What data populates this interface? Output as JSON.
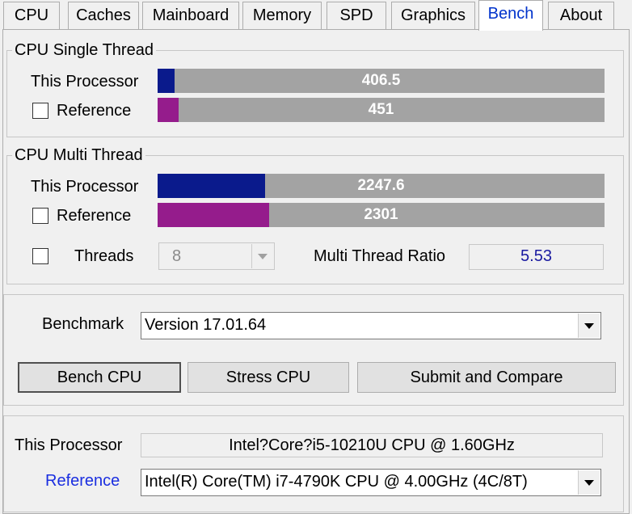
{
  "tabs": [
    {
      "label": "CPU"
    },
    {
      "label": "Caches"
    },
    {
      "label": "Mainboard"
    },
    {
      "label": "Memory"
    },
    {
      "label": "SPD"
    },
    {
      "label": "Graphics"
    },
    {
      "label": "Bench",
      "active": true
    },
    {
      "label": "About"
    }
  ],
  "single": {
    "title": "CPU Single Thread",
    "this_label": "This Processor",
    "this_value": "406.5",
    "this_fraction": 0.038,
    "ref_label": "Reference",
    "ref_checked": false,
    "ref_value": "451",
    "ref_fraction": 0.047
  },
  "multi": {
    "title": "CPU Multi Thread",
    "this_label": "This Processor",
    "this_value": "2247.6",
    "this_fraction": 0.24,
    "ref_label": "Reference",
    "ref_checked": false,
    "ref_value": "2301",
    "ref_fraction": 0.25,
    "threads_label": "Threads",
    "threads_checked": false,
    "threads_value": "8",
    "ratio_label": "Multi Thread Ratio",
    "ratio_value": "5.53"
  },
  "benchmark": {
    "label": "Benchmark",
    "version": "Version 17.01.64",
    "bench_cpu": "Bench CPU",
    "stress_cpu": "Stress CPU",
    "submit": "Submit and Compare"
  },
  "processors": {
    "this_label": "This Processor",
    "this_value": "Intel?Core?i5-10210U CPU @ 1.60GHz",
    "ref_label": "Reference",
    "ref_value": "Intel(R) Core(TM) i7-4790K CPU @ 4.00GHz (4C/8T)"
  },
  "colors": {
    "this_bar": "#0a1a8c",
    "ref_bar": "#951c8c",
    "bar_bg": "#a3a3a3",
    "active_tab": "#0033cc",
    "link": "#1a2ee0",
    "ratio": "#1a1aa0"
  }
}
